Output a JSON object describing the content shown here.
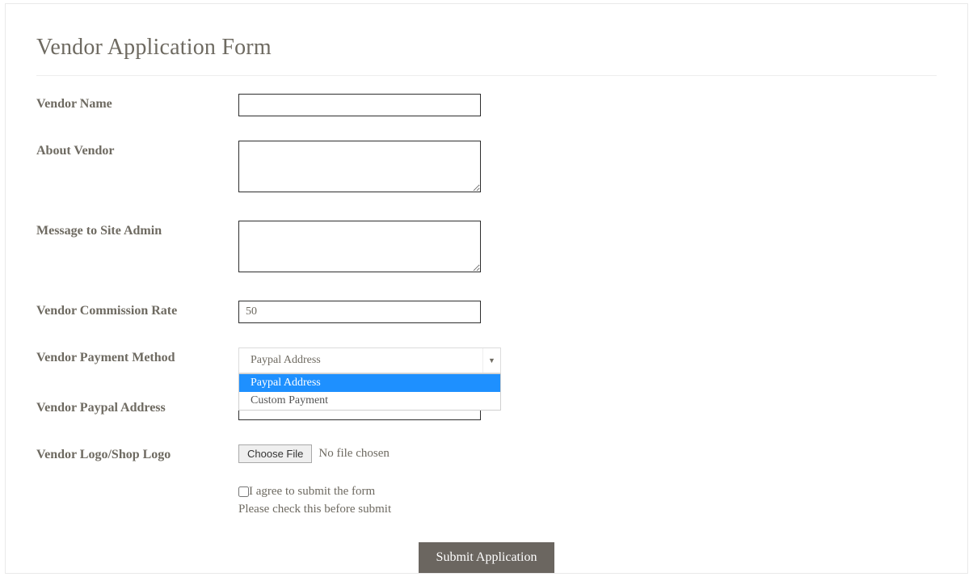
{
  "form": {
    "title": "Vendor Application Form",
    "labels": {
      "vendor_name": "Vendor Name",
      "about_vendor": "About Vendor",
      "message_admin": "Message to Site Admin",
      "commission_rate": "Vendor Commission Rate",
      "payment_method": "Vendor Payment Method",
      "paypal_address": "Vendor Paypal Address",
      "logo": "Vendor Logo/Shop Logo"
    },
    "values": {
      "vendor_name": "",
      "about_vendor": "",
      "message_admin": "",
      "commission_rate": "50",
      "payment_method_selected": "Paypal Address",
      "paypal_address": "",
      "file_status": "No file chosen"
    },
    "payment_method_options": [
      "Paypal Address",
      "Custom Payment"
    ],
    "file_button": "Choose File",
    "agree": {
      "label": "I agree to submit the form",
      "hint": "Please check this before submit",
      "checked": false
    },
    "submit_label": "Submit Application"
  }
}
